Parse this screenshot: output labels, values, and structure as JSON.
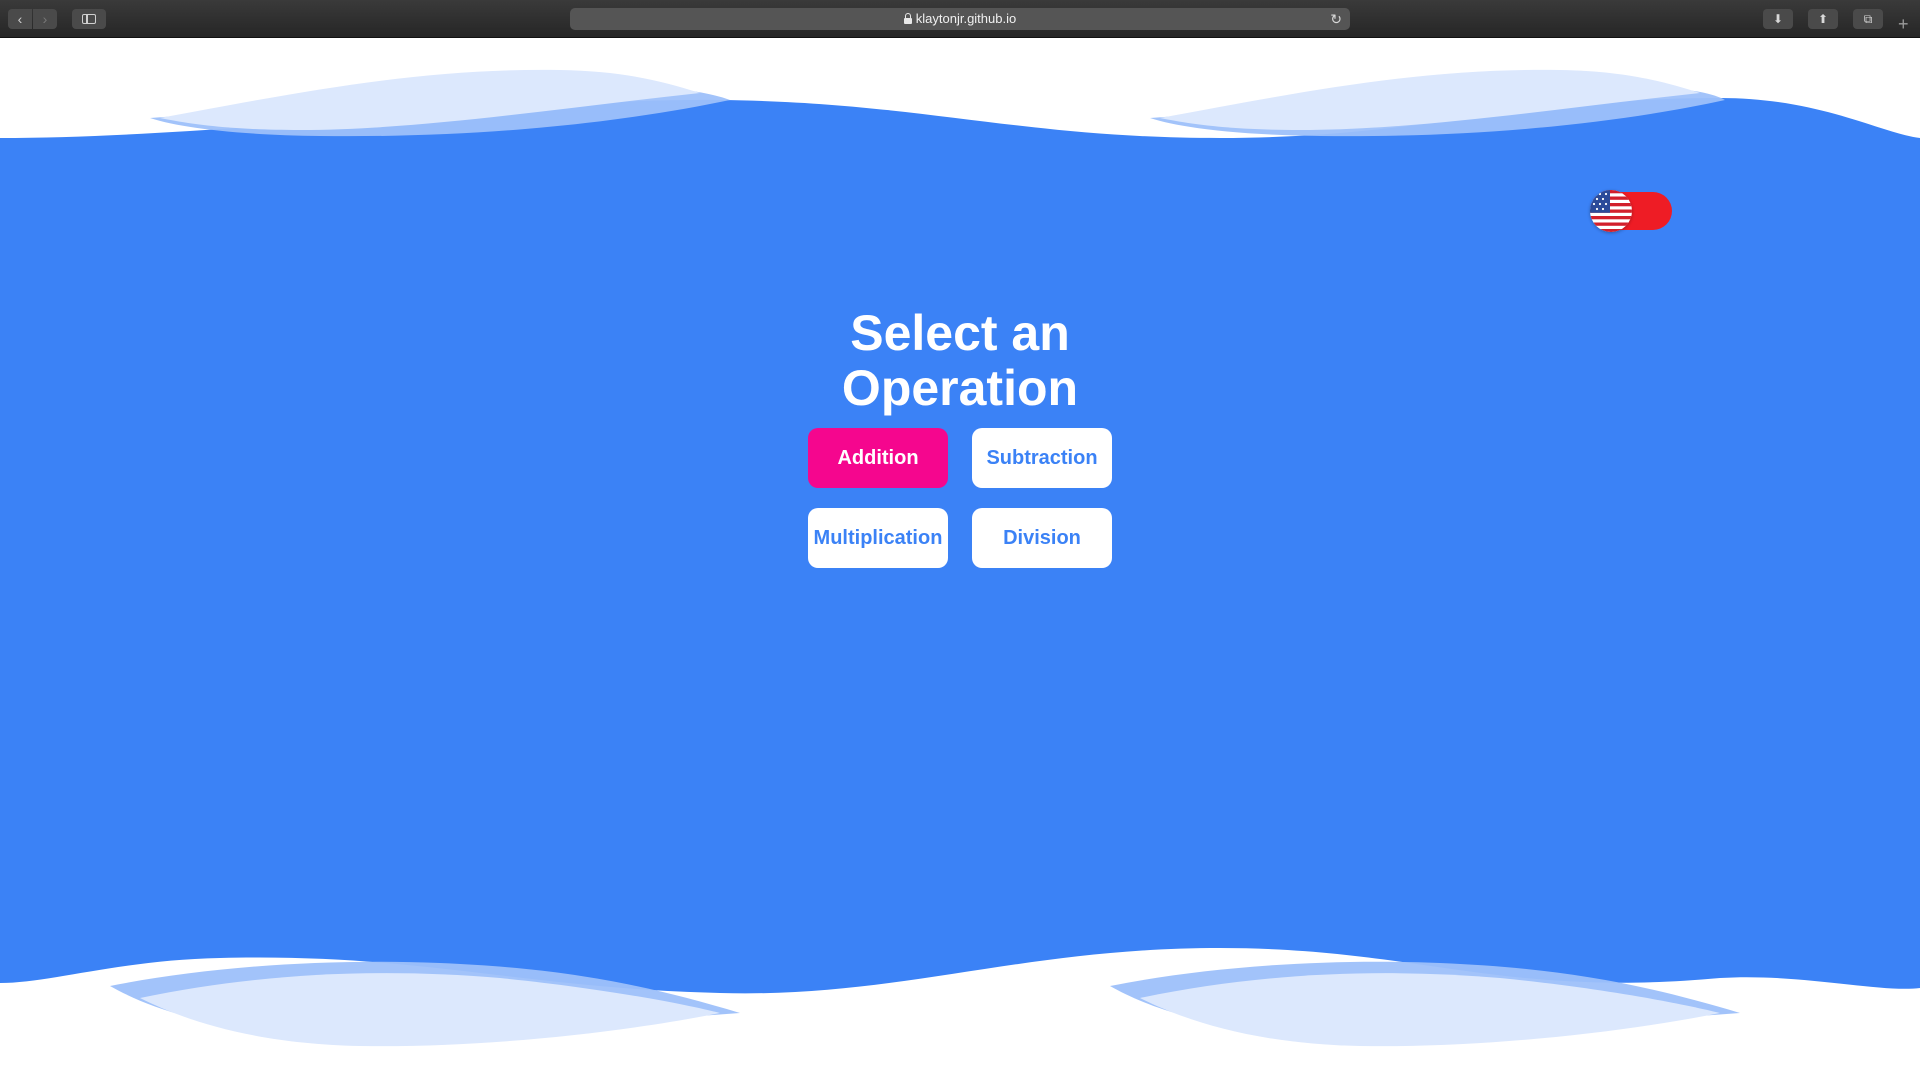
{
  "browser": {
    "address": "klaytonjr.github.io",
    "icons": {
      "back": "chevron-left-icon",
      "forward": "chevron-right-icon",
      "sidebar": "sidebar-icon",
      "lock": "lock-icon",
      "reload": "reload-icon",
      "download": "download-icon",
      "share": "share-icon",
      "tabs": "tabs-icon",
      "new_tab": "plus-icon"
    }
  },
  "page": {
    "title": "Select an Operation",
    "language_toggle": {
      "flag": "us-flag-icon",
      "color": "#ee1c25"
    },
    "operations": [
      {
        "label": "Addition",
        "selected": true
      },
      {
        "label": "Subtraction",
        "selected": false
      },
      {
        "label": "Multiplication",
        "selected": false
      },
      {
        "label": "Division",
        "selected": false
      }
    ]
  },
  "colors": {
    "background_blue": "#3b82f6",
    "selected_button": "#f5068e",
    "button_text": "#3b82f6",
    "wave_light": "#dce8fd",
    "wave_mid": "#9dc0fa"
  }
}
